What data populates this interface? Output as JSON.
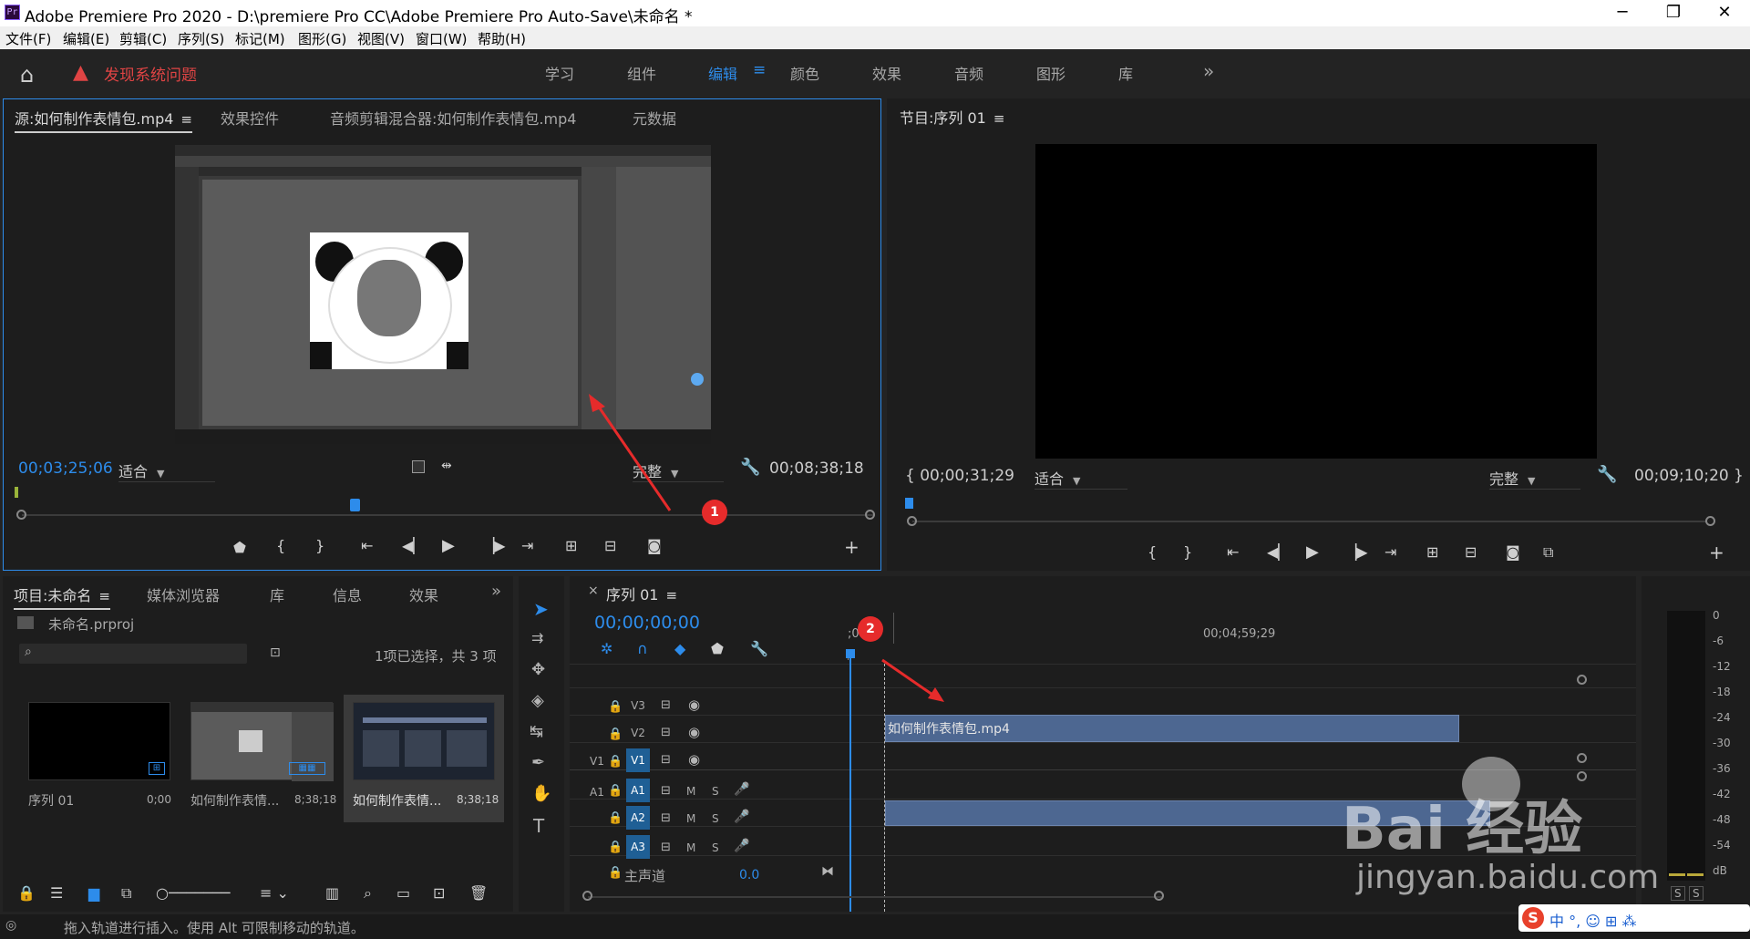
{
  "app": {
    "title": "Adobe Premiere Pro 2020 - D:\\premiere Pro CC\\Adobe Premiere Pro Auto-Save\\未命名 *",
    "logo": "Pr"
  },
  "menu": [
    "文件(F)",
    "编辑(E)",
    "剪辑(C)",
    "序列(S)",
    "标记(M)",
    "图形(G)",
    "视图(V)",
    "窗口(W)",
    "帮助(H)"
  ],
  "topbar": {
    "warning": "发现系统问题",
    "workspaces": [
      "学习",
      "组件",
      "编辑",
      "颜色",
      "效果",
      "音频",
      "图形",
      "库"
    ],
    "active": "编辑",
    "more": "»"
  },
  "source": {
    "tabs": [
      "源:如何制作表情包.mp4",
      "效果控件",
      "音频剪辑混合器:如何制作表情包.mp4",
      "元数据"
    ],
    "timecode": "00;03;25;06",
    "fit": "适合",
    "quality": "完整",
    "duration": "00;08;38;18",
    "playhead_fraction": 0.39
  },
  "program": {
    "tab": "节目:序列 01",
    "timecode": "00;00;31;29",
    "fit": "适合",
    "quality": "完整",
    "duration": "00;09;10;20"
  },
  "project": {
    "tabs": [
      "项目:未命名",
      "媒体浏览器",
      "库",
      "信息",
      "效果"
    ],
    "file": "未命名.prproj",
    "selection": "1项已选择，共 3 项",
    "items": [
      {
        "name": "序列 01",
        "dur": "0;00"
      },
      {
        "name": "如何制作表情...",
        "dur": "8;38;18"
      },
      {
        "name": "如何制作表情...",
        "dur": "8;38;18"
      }
    ]
  },
  "timeline": {
    "tab": "序列 01",
    "timecode": "00;00;00;00",
    "ruler_start": ";00",
    "ruler_mark": "00;04;59;29",
    "tracks": {
      "video": [
        "V3",
        "V2",
        "V1"
      ],
      "audio": [
        "A1",
        "A2",
        "A3"
      ]
    },
    "src_v": "V1",
    "src_a": "A1",
    "clip_label": "如何制作表情包.mp4",
    "master": "主声道",
    "master_val": "0.0",
    "mute": "M",
    "solo": "S"
  },
  "meter": {
    "ticks": [
      "0",
      "-6",
      "-12",
      "-18",
      "-24",
      "-30",
      "-36",
      "-42",
      "-48",
      "-54",
      "dB"
    ],
    "solo": [
      "S",
      "S"
    ]
  },
  "status": "拖入轨道进行插入。使用 Alt 可限制移动的轨道。",
  "watermark": {
    "brand": "Bai  经验",
    "url": "jingyan.baidu.com"
  },
  "ime": "中 °, ☺ ⊞ ⁂",
  "annotations": [
    "1",
    "2"
  ],
  "colors": {
    "accent": "#2d8ceb",
    "clip": "#4d6791",
    "annotation": "#e62b2b",
    "warning": "#e04444"
  }
}
